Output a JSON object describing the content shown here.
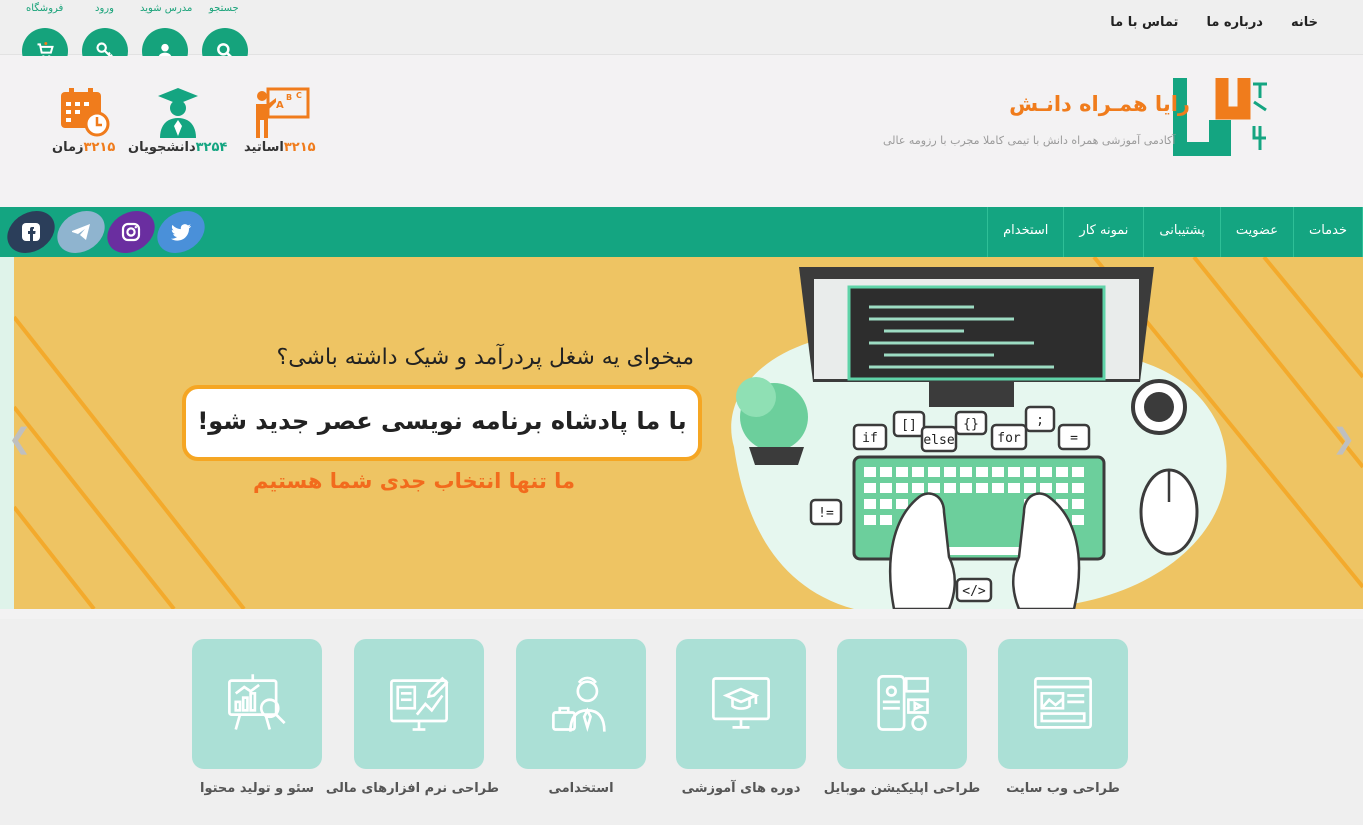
{
  "top_nav": {
    "items": [
      "خانه",
      "درباره ما",
      "تماس با ما"
    ]
  },
  "quick_links": {
    "search_label": "جستجو",
    "teacher_label": "مدرس شوید",
    "login_label": "ورود",
    "shop_label": "فروشگاه"
  },
  "brand": {
    "name": "رایا همـراه دانـش",
    "tagline": "آکادمی آموزشی همراه دانش با تیمی کاملا مجرب با رزومه عالی"
  },
  "stats": [
    {
      "label": "اساتید",
      "value": "۳۲۱۵"
    },
    {
      "label": "دانشجویان",
      "value": "۳۲۵۴"
    },
    {
      "label": "زمان",
      "value": "۳۲۱۵"
    }
  ],
  "main_nav": {
    "items": [
      "خدمات",
      "عضویت",
      "پشتیبانی",
      "نمونه کار",
      "استخدام"
    ]
  },
  "socials": [
    "twitter-icon",
    "instagram-icon",
    "telegram-icon",
    "facebook-icon"
  ],
  "banner": {
    "question": "میخوای یه شغل پردرآمد و شیک داشته باشی؟",
    "headline": "با ما پادشاه برنامه نویسی عصر جدید شو!",
    "subline": "ما تنها انتخاب جدی شما هستیم",
    "code_labels": [
      "if",
      "[]",
      "else",
      "{}",
      "for",
      ";",
      "=",
      "!=",
      "</>"
    ]
  },
  "services": [
    {
      "label": "طراحی وب سایت",
      "icon": "website-icon"
    },
    {
      "label": "طراحی اپلیکیشن موبایل",
      "icon": "mobile-app-icon"
    },
    {
      "label": "دوره های آموزشی",
      "icon": "course-icon"
    },
    {
      "label": "استخدامی",
      "icon": "employee-icon"
    },
    {
      "label": "طراحی نرم افزارهای مالی",
      "icon": "finance-software-icon"
    },
    {
      "label": "سئو و تولید محتوا",
      "icon": "seo-icon"
    }
  ],
  "colors": {
    "primary_green": "#14a581",
    "accent_orange": "#f07c1c",
    "banner_yellow": "#eec463",
    "service_tile": "#abe0d6"
  }
}
